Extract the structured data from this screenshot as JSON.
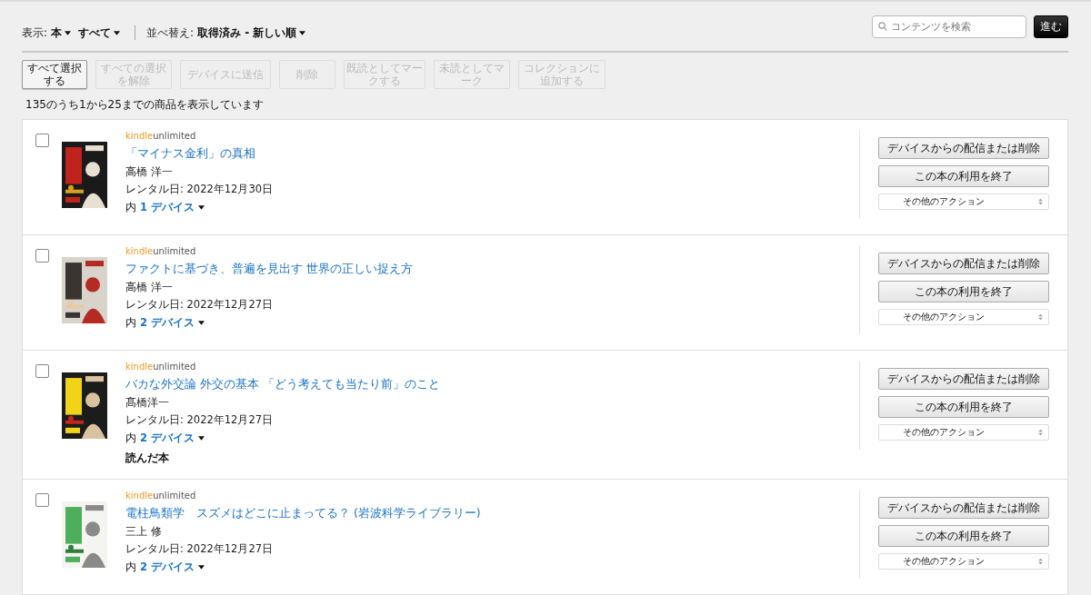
{
  "filters": {
    "show_label": "表示:",
    "format": "本",
    "scope": "すべて",
    "sort_label": "並べ替え:",
    "sort": "取得済み - 新しい順"
  },
  "search": {
    "placeholder": "コンテンツを検索",
    "button": "進む"
  },
  "toolbar": [
    {
      "label": "すべて選択する",
      "disabled": false
    },
    {
      "label": "すべての選択を解除",
      "disabled": true
    },
    {
      "label": "デバイスに送信",
      "disabled": true
    },
    {
      "label": "削除",
      "disabled": true
    },
    {
      "label": "既読としてマークする",
      "disabled": true
    },
    {
      "label": "未読としてマーク",
      "disabled": true
    },
    {
      "label": "コレクションに追加する",
      "disabled": true
    }
  ],
  "count_text": "135のうち1から25までの商品を表示しています",
  "items": [
    {
      "checked": false,
      "brand": "kindle",
      "plan": "unlimited",
      "title": "「マイナス金利」の真相",
      "author": "高橋 洋一",
      "rental_date": "レンタル日: 2022年12月30日",
      "devices_prefix": "内",
      "devices": "1 デバイス",
      "actions": [
        "デバイスからの配信または削除",
        "この本の利用を終了"
      ],
      "more": "その他のアクション"
    },
    {
      "checked": false,
      "brand": "kindle",
      "plan": "unlimited",
      "title": "ファクトに基づき、普遍を見出す 世界の正しい捉え方",
      "author": "高橋 洋一",
      "rental_date": "レンタル日: 2022年12月27日",
      "devices_prefix": "内",
      "devices": "2 デバイス",
      "actions": [
        "デバイスからの配信または削除",
        "この本の利用を終了"
      ],
      "more": "その他のアクション"
    },
    {
      "checked": false,
      "brand": "kindle",
      "plan": "unlimited",
      "title": "バカな外交論 外交の基本 「どう考えても当たり前」のこと",
      "author": "髙橋洋一",
      "rental_date": "レンタル日: 2022年12月27日",
      "devices_prefix": "内",
      "devices": "2 デバイス",
      "note": "読んだ本",
      "actions": [
        "デバイスからの配信または削除",
        "この本の利用を終了"
      ],
      "more": "その他のアクション"
    },
    {
      "checked": false,
      "brand": "kindle",
      "plan": "unlimited",
      "title": "電柱鳥類学　スズメはどこに止まってる？ (岩波科学ライブラリー)",
      "author": "三上 修",
      "rental_date": "レンタル日: 2022年12月27日",
      "devices_prefix": "内",
      "devices": "2 デバイス",
      "actions": [
        "デバイスからの配信または削除",
        "この本の利用を終了"
      ],
      "more": "その他のアクション"
    }
  ]
}
